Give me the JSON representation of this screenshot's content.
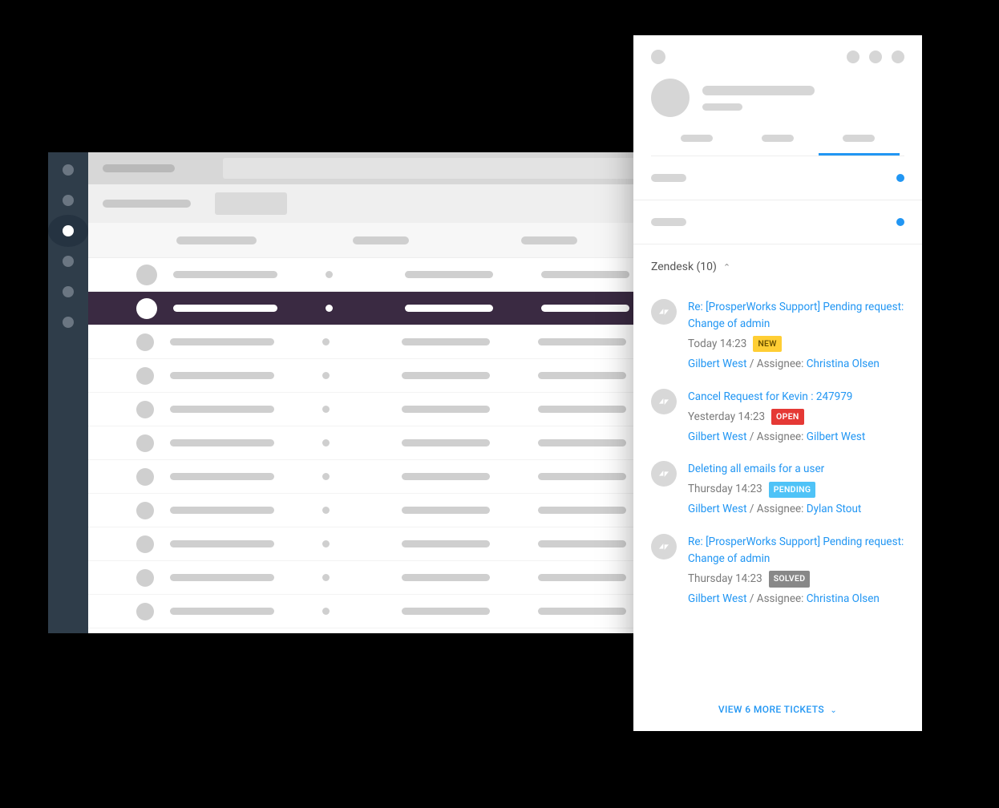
{
  "sidebar_nav_count": 6,
  "sidebar_active_index": 2,
  "list_rows": 11,
  "list_selected_index": 1,
  "zendesk": {
    "header": "Zendesk (10)",
    "more_label": "VIEW 6 MORE TICKETS",
    "assignee_prefix": " / Assignee: ",
    "tickets": [
      {
        "title": "Re: [ProsperWorks Support] Pending request: Change of admin",
        "time": "Today 14:23",
        "status": "NEW",
        "status_class": "new",
        "requester": "Gilbert West",
        "assignee": "Christina Olsen"
      },
      {
        "title": "Cancel Request for Kevin : 247979",
        "time": "Yesterday 14:23",
        "status": "OPEN",
        "status_class": "open",
        "requester": "Gilbert West",
        "assignee": "Gilbert West"
      },
      {
        "title": "Deleting all emails for a user",
        "time": "Thursday 14:23",
        "status": "PENDING",
        "status_class": "pending",
        "requester": "Gilbert West",
        "assignee": "Dylan Stout"
      },
      {
        "title": "Re: [ProsperWorks Support] Pending request: Change of admin",
        "time": "Thursday 14:23",
        "status": "SOLVED",
        "status_class": "solved",
        "requester": "Gilbert West",
        "assignee": "Christina Olsen"
      }
    ]
  }
}
